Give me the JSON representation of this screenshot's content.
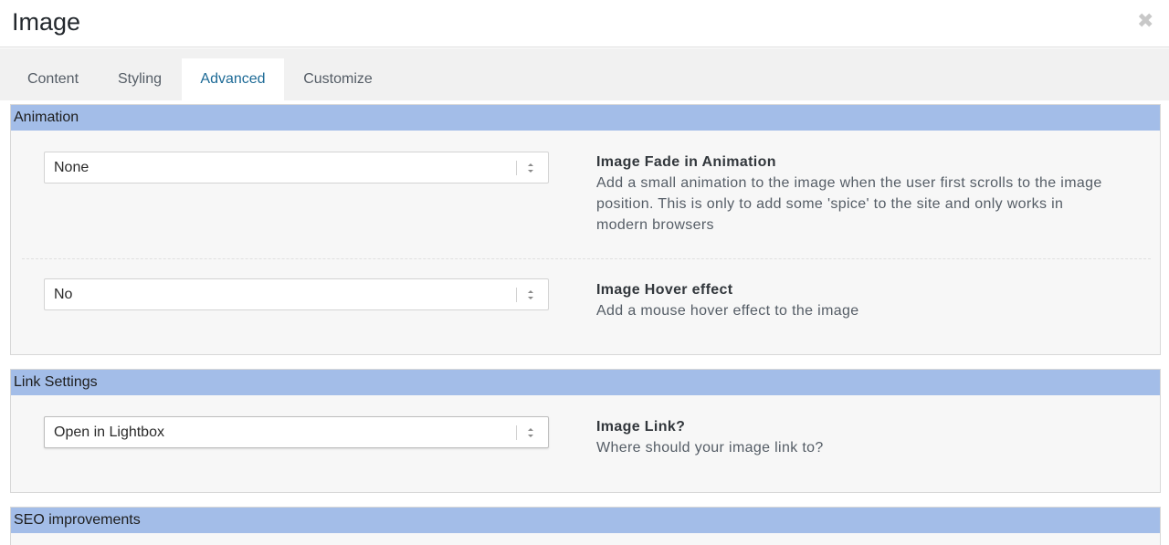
{
  "window": {
    "title": "Image"
  },
  "tabs": [
    {
      "label": "Content"
    },
    {
      "label": "Styling"
    },
    {
      "label": "Advanced"
    },
    {
      "label": "Customize"
    }
  ],
  "active_tab": "Advanced",
  "sections": {
    "animation": {
      "header": "Animation",
      "fade": {
        "value": "None",
        "title": "Image Fade in Animation",
        "description": "Add a small animation to the image when the user first scrolls to the image position. This is only to add some 'spice' to the site and only works in modern browsers"
      },
      "hover": {
        "value": "No",
        "title": "Image Hover effect",
        "description": "Add a mouse hover effect to the image"
      }
    },
    "link": {
      "header": "Link Settings",
      "image_link": {
        "value": "Open in Lightbox",
        "title": "Image Link?",
        "description": "Where should your image link to?"
      }
    },
    "seo": {
      "header": "SEO improvements"
    }
  },
  "icons": {
    "close": "close-x-icon",
    "select_arrows": "updown-arrows-icon"
  },
  "colors": {
    "section_header": "#a3bde8",
    "active_tab_text": "#1d6a96",
    "tab_bar": "#f1f1f1"
  }
}
